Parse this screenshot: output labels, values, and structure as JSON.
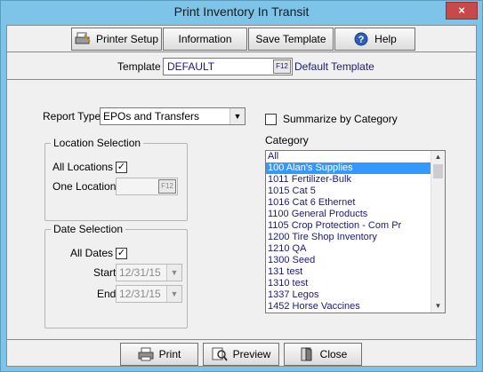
{
  "window": {
    "title": "Print Inventory In Transit",
    "close_glyph": "×"
  },
  "toolbar": {
    "printer_setup": "Printer Setup",
    "information": "Information",
    "save_template": "Save Template",
    "help": "Help"
  },
  "template": {
    "label": "Template",
    "value": "DEFAULT",
    "f12": "F12",
    "description": "Default Template"
  },
  "report_type": {
    "label": "Report Type",
    "value": "EPOs and Transfers"
  },
  "summarize": {
    "label": "Summarize by Category",
    "checked": false
  },
  "location": {
    "title": "Location Selection",
    "all_label": "All Locations",
    "all_checked": true,
    "one_label": "One Location",
    "one_value": "",
    "f12": "F12"
  },
  "date": {
    "title": "Date Selection",
    "all_label": "All Dates",
    "all_checked": true,
    "start_label": "Start",
    "start_value": "12/31/15",
    "end_label": "End",
    "end_value": "12/31/15"
  },
  "category": {
    "label": "Category",
    "items": [
      "All",
      "100 Alan's Supplies",
      "1011 Fertilizer-Bulk",
      "1015 Cat 5",
      "1016 Cat 6 Ethernet",
      "1100 General Products",
      "1105 Crop Protection - Com Pr",
      "1200 Tire Shop Inventory",
      "1210 QA",
      "1300 Seed",
      "131 test",
      "1310 test",
      "1337 Legos",
      "1452 Horse Vaccines"
    ],
    "selected_index": 1
  },
  "footer": {
    "print": "Print",
    "preview": "Preview",
    "close": "Close"
  },
  "icons": {
    "check": "✓",
    "dropdown": "▼",
    "scroll_up": "▲",
    "scroll_down": "▼"
  }
}
